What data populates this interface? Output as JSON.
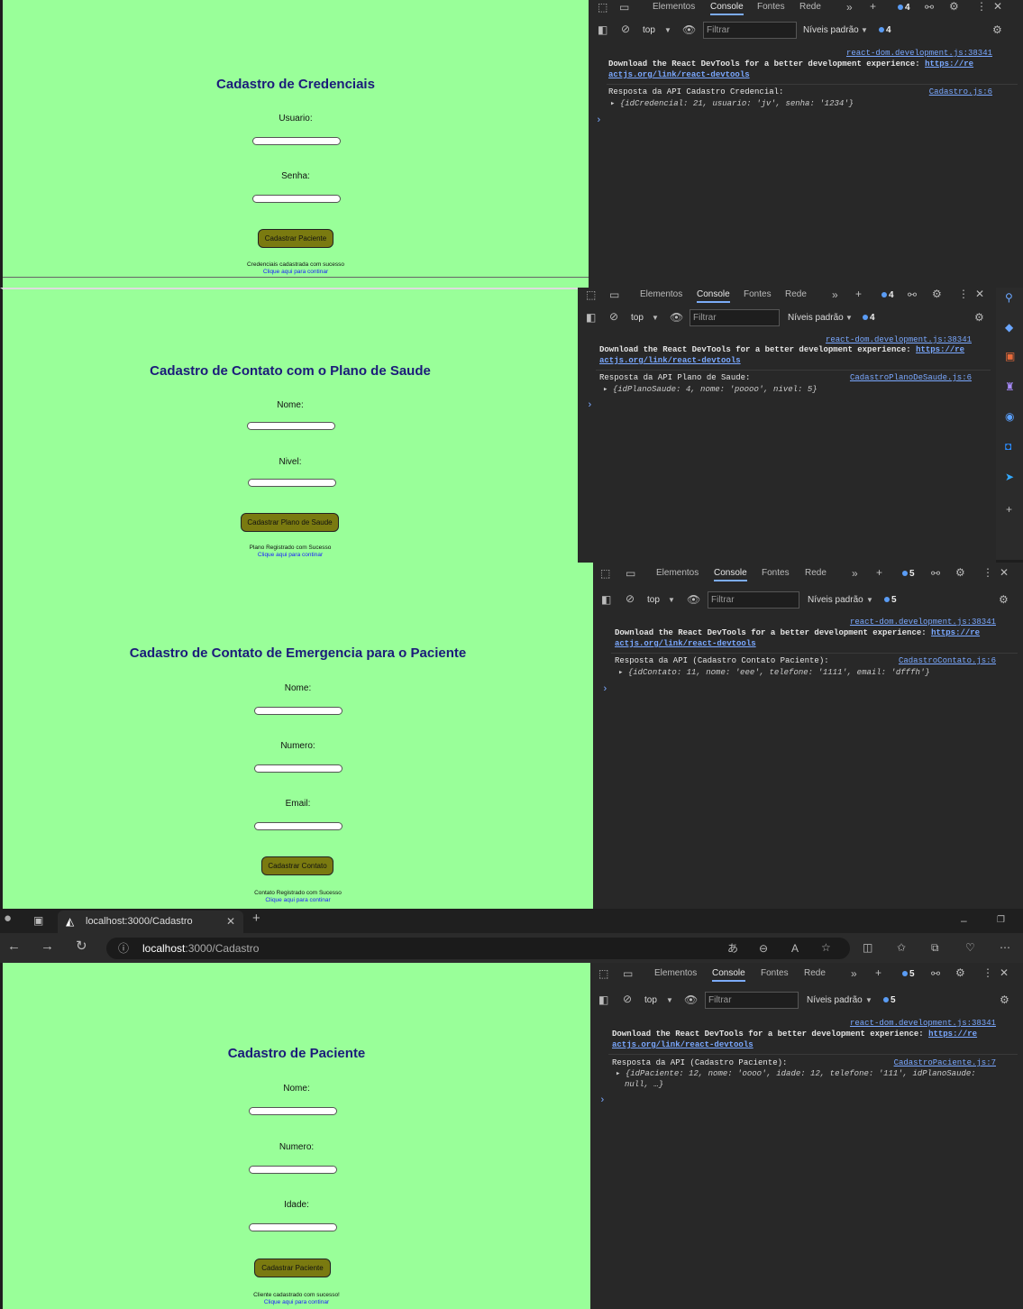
{
  "panels": [
    {
      "app": {
        "title": "Cadastro de Credenciais",
        "fields": [
          {
            "label": "Usuario:"
          },
          {
            "label": "Senha:"
          }
        ],
        "button": "Cadastrar Paciente",
        "message": "Credenciais cadastrada com sucesso",
        "link": "Clique aqui para continar"
      },
      "devtools": {
        "tabs": [
          "Elementos",
          "Console",
          "Fontes",
          "Rede"
        ],
        "badge": "4",
        "context": "top",
        "filter_placeholder": "Filtrar",
        "levels": "Níveis padrão",
        "issues": "4",
        "react_src": "react-dom.development.js:38341",
        "react_msg": "Download the React DevTools for a better development experience: ",
        "react_url_a": "https://re",
        "react_url_b": "actjs.org/link/react-devtools",
        "log_label": "Resposta da API Cadastro Credencial:",
        "log_src": "Cadastro.js:6",
        "log_obj": "{idCredencial: 21, usuario: 'jv', senha: '1234'}"
      }
    },
    {
      "app": {
        "title": "Cadastro de Contato com o Plano de Saude",
        "fields": [
          {
            "label": "Nome:"
          },
          {
            "label": "Nivel:"
          }
        ],
        "button": "Cadastrar Plano de Saude",
        "message": "Plano Registrado com Sucesso",
        "link": "Clique aqui para continar"
      },
      "devtools": {
        "tabs": [
          "Elementos",
          "Console",
          "Fontes",
          "Rede"
        ],
        "badge": "4",
        "context": "top",
        "filter_placeholder": "Filtrar",
        "levels": "Níveis padrão",
        "issues": "4",
        "react_src": "react-dom.development.js:38341",
        "react_msg": "Download the React DevTools for a better development experience: ",
        "react_url_a": "https://re",
        "react_url_b": "actjs.org/link/react-devtools",
        "log_label": "Resposta da API Plano de Saude:",
        "log_src": "CadastroPlanoDeSaude.js:6",
        "log_obj": "{idPlanoSaude: 4, nome: 'poooo', nivel: 5}"
      }
    },
    {
      "app": {
        "title": "Cadastro de Contato de Emergencia para o Paciente",
        "fields": [
          {
            "label": "Nome:"
          },
          {
            "label": "Numero:"
          },
          {
            "label": "Email:"
          }
        ],
        "button": "Cadastrar Contato",
        "message": "Contato Registrado com Sucesso",
        "link": "Clique aqui para continar"
      },
      "devtools": {
        "tabs": [
          "Elementos",
          "Console",
          "Fontes",
          "Rede"
        ],
        "badge": "5",
        "context": "top",
        "filter_placeholder": "Filtrar",
        "levels": "Níveis padrão",
        "issues": "5",
        "react_src": "react-dom.development.js:38341",
        "react_msg": "Download the React DevTools for a better development experience: ",
        "react_url_a": "https://re",
        "react_url_b": "actjs.org/link/react-devtools",
        "log_label": "Resposta da API (Cadastro Contato Paciente):",
        "log_src": "CadastroContato.js:6",
        "log_obj": "{idContato: 11, nome: 'eee', telefone: '1111', email: 'dfffh'}"
      }
    },
    {
      "app": {
        "title": "Cadastro de Paciente",
        "fields": [
          {
            "label": "Nome:"
          },
          {
            "label": "Numero:"
          },
          {
            "label": "Idade:"
          }
        ],
        "button": "Cadastrar Paciente",
        "message": "Cliente cadastrado com sucesso!",
        "link": "Clique aqui para continar"
      },
      "devtools": {
        "tabs": [
          "Elementos",
          "Console",
          "Fontes",
          "Rede"
        ],
        "badge": "5",
        "context": "top",
        "filter_placeholder": "Filtrar",
        "levels": "Níveis padrão",
        "issues": "5",
        "react_src": "react-dom.development.js:38341",
        "react_msg": "Download the React DevTools for a better development experience: ",
        "react_url_a": "https://re",
        "react_url_b": "actjs.org/link/react-devtools",
        "log_label": "Resposta da API (Cadastro Paciente):",
        "log_src": "CadastroPaciente.js:7",
        "log_obj": "{idPaciente: 12, nome: 'oooo', idade: 12, telefone: '111', idPlanoSaude:",
        "log_obj2": "null, …}"
      }
    }
  ],
  "browser": {
    "tab_title": "localhost:3000/Cadastro",
    "url_host": "localhost",
    "url_path": ":3000/Cadastro"
  },
  "colors": {
    "app_bg": "#99ff99",
    "title": "#1b1b7a",
    "button": "#7a7a10",
    "link": "#1a1aff",
    "devtools_bg": "#282828"
  }
}
